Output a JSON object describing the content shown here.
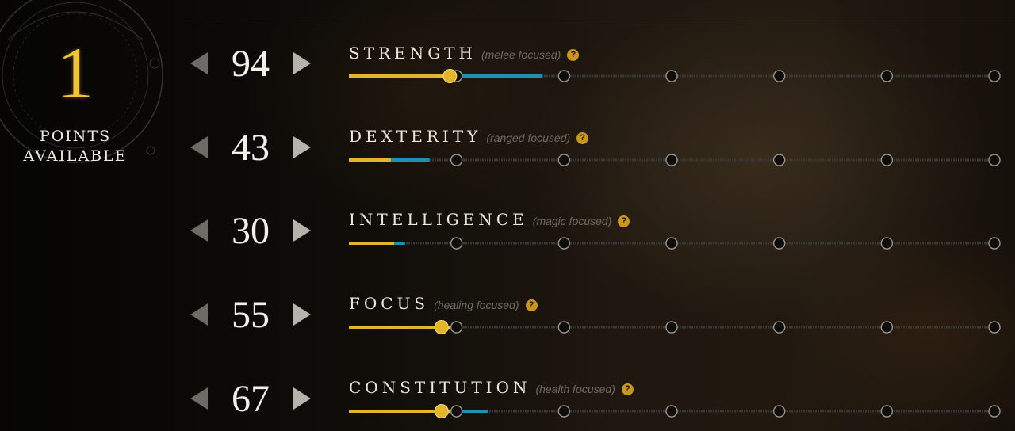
{
  "points": {
    "value": "1",
    "label": "POINTS\nAVAILABLE"
  },
  "help_glyph": "?",
  "colors": {
    "gold": "#e3b52c",
    "blue": "#1f8fb3",
    "track": "#3a3836",
    "node": "#0e0d0c",
    "accent_help": "#c9961e"
  },
  "stats": [
    {
      "name": "STRENGTH",
      "subtitle": "(melee focused)",
      "value": "94",
      "base_fraction": 0.17,
      "bonus_fraction": 0.3,
      "handle": true
    },
    {
      "name": "DEXTERITY",
      "subtitle": "(ranged focused)",
      "value": "43",
      "base_fraction": 0.065,
      "bonus_fraction": 0.125,
      "handle": false
    },
    {
      "name": "INTELLIGENCE",
      "subtitle": "(magic focused)",
      "value": "30",
      "base_fraction": 0.07,
      "bonus_fraction": 0.087,
      "handle": false
    },
    {
      "name": "FOCUS",
      "subtitle": "(healing focused)",
      "value": "55",
      "base_fraction": 0.157,
      "bonus_fraction": 0.157,
      "handle": true
    },
    {
      "name": "CONSTITUTION",
      "subtitle": "(health focused)",
      "value": "67",
      "base_fraction": 0.157,
      "bonus_fraction": 0.215,
      "handle": true
    }
  ]
}
